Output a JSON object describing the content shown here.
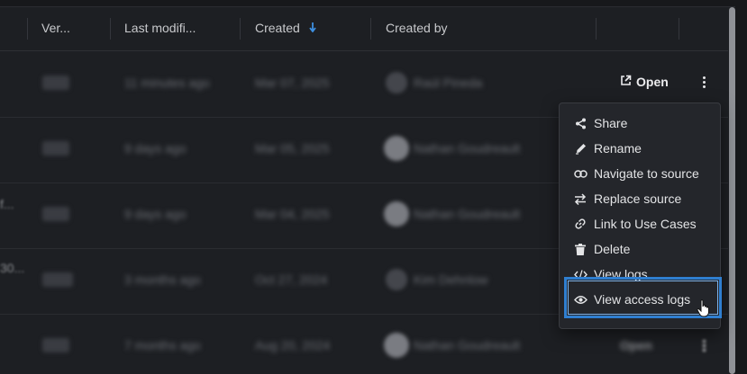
{
  "header": {
    "version": "Ver...",
    "last_modified": "Last modifi...",
    "created": "Created",
    "created_sort_icon": "arrow-down-icon",
    "created_by": "Created by"
  },
  "rows": [
    {
      "version": "v1",
      "modified": "11 minutes ago",
      "created": "Mar 07, 2025",
      "author": "Raúl Pineda",
      "left": "",
      "open": "Open"
    },
    {
      "version": "v1",
      "modified": "9 days ago",
      "created": "Mar 05, 2025",
      "author": "Nathan Goudreault",
      "left": ""
    },
    {
      "version": "v1",
      "modified": "9 days ago",
      "created": "Mar 04, 2025",
      "author": "Nathan Goudreault",
      "left": "f..."
    },
    {
      "version": "v17",
      "modified": "3 months ago",
      "created": "Oct 27, 2024",
      "author": "Kim Dehnlow",
      "left": "30..."
    },
    {
      "version": "v1",
      "modified": "7 months ago",
      "created": "Aug 20, 2024",
      "author": "Nathan Goudreault",
      "left": "",
      "open": "Open"
    }
  ],
  "menu": {
    "items": [
      {
        "label": "Share",
        "icon": "share-icon"
      },
      {
        "label": "Rename",
        "icon": "pencil-icon"
      },
      {
        "label": "Navigate to source",
        "icon": "link-icon"
      },
      {
        "label": "Replace source",
        "icon": "swap-arrows-icon"
      },
      {
        "label": "Link to Use Cases",
        "icon": "link-icon"
      },
      {
        "label": "Delete",
        "icon": "trash-icon"
      },
      {
        "label": "View logs",
        "icon": "code-icon"
      },
      {
        "label": "View access logs",
        "icon": "eye-icon"
      }
    ]
  },
  "colors": {
    "background": "#1d1f23",
    "menu_background": "#24262b",
    "highlight": "#2f7fd1",
    "sort_arrow": "#3d8fe0"
  }
}
